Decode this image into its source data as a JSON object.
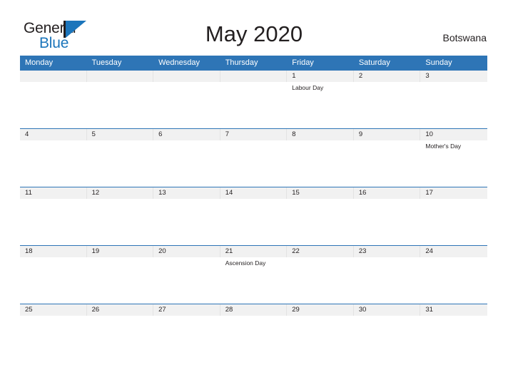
{
  "brand": {
    "name_top": "General",
    "name_bottom": "Blue",
    "mark": "flag-triangle",
    "accent_color": "#1b75bb"
  },
  "header": {
    "title": "May 2020",
    "region": "Botswana"
  },
  "calendar": {
    "header_bg": "#2e75b6",
    "date_row_bg": "#f1f1f1",
    "weekdays": [
      "Monday",
      "Tuesday",
      "Wednesday",
      "Thursday",
      "Friday",
      "Saturday",
      "Sunday"
    ],
    "weeks": [
      {
        "dates": [
          "",
          "",
          "",
          "",
          "1",
          "2",
          "3"
        ],
        "events": [
          "",
          "",
          "",
          "",
          "Labour Day",
          "",
          ""
        ]
      },
      {
        "dates": [
          "4",
          "5",
          "6",
          "7",
          "8",
          "9",
          "10"
        ],
        "events": [
          "",
          "",
          "",
          "",
          "",
          "",
          "Mother's Day"
        ]
      },
      {
        "dates": [
          "11",
          "12",
          "13",
          "14",
          "15",
          "16",
          "17"
        ],
        "events": [
          "",
          "",
          "",
          "",
          "",
          "",
          ""
        ]
      },
      {
        "dates": [
          "18",
          "19",
          "20",
          "21",
          "22",
          "23",
          "24"
        ],
        "events": [
          "",
          "",
          "",
          "Ascension Day",
          "",
          "",
          ""
        ]
      },
      {
        "dates": [
          "25",
          "26",
          "27",
          "28",
          "29",
          "30",
          "31"
        ],
        "events": [
          "",
          "",
          "",
          "",
          "",
          "",
          ""
        ]
      }
    ]
  }
}
